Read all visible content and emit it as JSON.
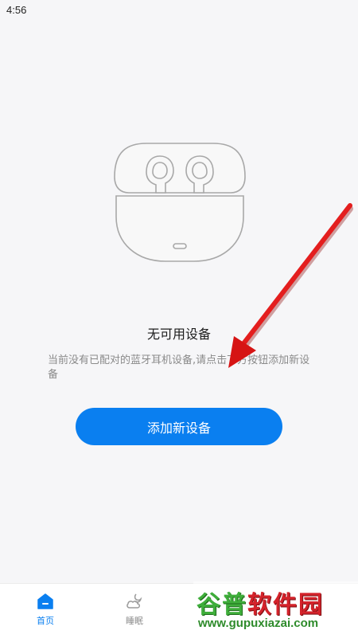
{
  "status_bar": {
    "time": "4:56"
  },
  "empty_state": {
    "illustration": "earbuds-case-icon",
    "title": "无可用设备",
    "description": "当前没有已配对的蓝牙耳机设备,请点击下方按钮添加新设备"
  },
  "add_button": {
    "label": "添加新设备"
  },
  "bottom_nav": {
    "items": [
      {
        "label": "首页",
        "icon": "home-icon",
        "active": true
      },
      {
        "label": "睡眠",
        "icon": "sleep-weather-icon",
        "active": false
      }
    ]
  },
  "watermark": {
    "title_part1": "谷普",
    "title_part2": "软件园",
    "url": "www.gupuxiazai.com"
  },
  "colors": {
    "accent": "#0a7ff0",
    "background": "#f6f6f8",
    "annotation_arrow": "#e01010"
  }
}
